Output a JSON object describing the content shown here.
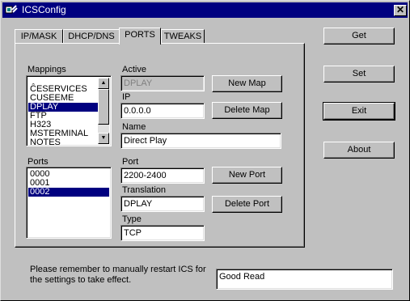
{
  "window": {
    "title": "ICSConfig",
    "close_glyph": "✕"
  },
  "tabs": [
    {
      "label": "IP/MASK",
      "active": false
    },
    {
      "label": "DHCP/DNS",
      "active": false
    },
    {
      "label": "PORTS",
      "active": true
    },
    {
      "label": "TWEAKS",
      "active": false
    }
  ],
  "side_buttons": {
    "get": "Get",
    "set": "Set",
    "exit": "Exit",
    "about": "About"
  },
  "ports_tab": {
    "mappings_label": "Mappings",
    "mappings_items": [
      "ĈESERVICES",
      "CUSEEME",
      "DPLAY",
      "FTP",
      "H323",
      "MSTERMINAL",
      "NOTES"
    ],
    "mappings_selected": "DPLAY",
    "active_label": "Active",
    "active_value": "DPLAY",
    "ip_label": "IP",
    "ip_value": "0.0.0.0",
    "name_label": "Name",
    "name_value": "Direct Play",
    "ports_label": "Ports",
    "ports_items": [
      "0000",
      "0001",
      "0002"
    ],
    "ports_selected": "0002",
    "port_label": "Port",
    "port_value": "2200-2400",
    "translation_label": "Translation",
    "translation_value": "DPLAY",
    "type_label": "Type",
    "type_value": "TCP",
    "new_map_label": "New Map",
    "delete_map_label": "Delete Map",
    "new_port_label": "New Port",
    "delete_port_label": "Delete Port"
  },
  "footer": {
    "notice": "Please remember to manually restart ICS for the settings to take effect.",
    "status_value": "Good Read"
  },
  "colors": {
    "titlebar": "#000080",
    "selection": "#000080",
    "face": "#c0c0c0"
  }
}
